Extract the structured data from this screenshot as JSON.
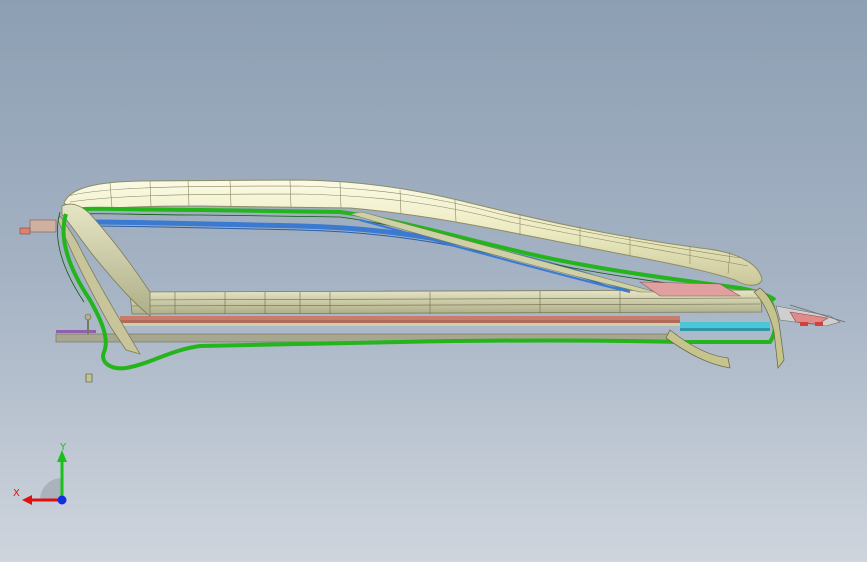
{
  "window": {
    "type": "3d-cad-viewport"
  },
  "triad": {
    "x_label": "X",
    "y_label": "Y",
    "x_color": "#e01010",
    "y_color": "#1cc01c",
    "z_color": "#1030e0"
  },
  "colors": {
    "background_top": "#8d9fb3",
    "background_bottom": "#cfd5dd",
    "seal_cream": "#efeec4",
    "seal_green": "#23b51b",
    "rail_tan": "#cfd0a6",
    "blue_trim": "#3a7ad0",
    "olive_bracket": "#c6c48e"
  }
}
